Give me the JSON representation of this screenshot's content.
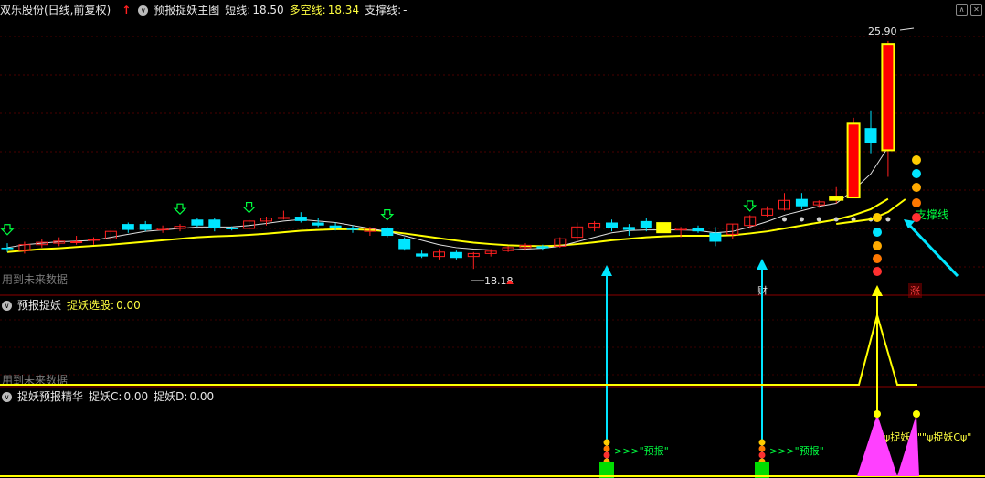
{
  "main_panel": {
    "title": "双乐股份(日线,前复权)",
    "indicator_name": "预报捉妖主图",
    "short_label": "短线:",
    "short_value": "18.50",
    "multi_label": "多空线:",
    "multi_value": "18.34",
    "support_label": "支撑线:",
    "support_value": "-",
    "future_note": "用到未来数据",
    "high_label": "25.90",
    "low_label": "18.18",
    "support_line_label": "支撑线",
    "cai_label": "财",
    "zhang_label": "涨"
  },
  "panel2": {
    "title": "预报捉妖",
    "field_label": "捉妖选股:",
    "field_value": "0.00",
    "future_note": "用到未来数据"
  },
  "panel3": {
    "title": "捉妖预报精华",
    "c_label": "捉妖C:",
    "c_value": "0.00",
    "d_label": "捉妖D:",
    "d_value": "0.00",
    "signal_text_1": ">>>\"预报\"",
    "signal_text_2": ">>>\"预报\"",
    "signal_text_3": "\"ψ捉妖C\"\"ψ捉妖Cψ\""
  },
  "colors": {
    "up": "#ff2020",
    "down": "#00e5ff",
    "ma": "#ffff00",
    "magenta": "#ff40ff",
    "green": "#00dd00"
  },
  "chart_data": {
    "type": "candlestick",
    "ohlc": [
      [
        18.9,
        19.05,
        18.75,
        18.85
      ],
      [
        18.8,
        19.1,
        18.7,
        19.0
      ],
      [
        19.0,
        19.2,
        18.9,
        19.08
      ],
      [
        19.05,
        19.25,
        18.95,
        19.12
      ],
      [
        19.1,
        19.3,
        19.0,
        19.1
      ],
      [
        19.15,
        19.25,
        19.0,
        19.18
      ],
      [
        19.2,
        19.5,
        19.1,
        19.45
      ],
      [
        19.7,
        19.75,
        19.4,
        19.5
      ],
      [
        19.7,
        19.8,
        19.45,
        19.5
      ],
      [
        19.5,
        19.65,
        19.4,
        19.55
      ],
      [
        19.55,
        19.7,
        19.45,
        19.62
      ],
      [
        19.85,
        19.9,
        19.6,
        19.65
      ],
      [
        19.85,
        19.9,
        19.45,
        19.55
      ],
      [
        19.55,
        19.62,
        19.48,
        19.52
      ],
      [
        19.55,
        19.85,
        19.5,
        19.8
      ],
      [
        19.8,
        19.95,
        19.65,
        19.9
      ],
      [
        19.9,
        20.15,
        19.85,
        19.92
      ],
      [
        19.95,
        20.1,
        19.75,
        19.8
      ],
      [
        19.75,
        19.9,
        19.6,
        19.65
      ],
      [
        19.65,
        19.75,
        19.48,
        19.55
      ],
      [
        19.55,
        19.65,
        19.4,
        19.5
      ],
      [
        19.45,
        19.6,
        19.3,
        19.55
      ],
      [
        19.55,
        19.6,
        19.25,
        19.3
      ],
      [
        19.2,
        19.25,
        18.8,
        18.85
      ],
      [
        18.7,
        18.8,
        18.55,
        18.6
      ],
      [
        18.6,
        18.85,
        18.5,
        18.75
      ],
      [
        18.75,
        18.8,
        18.5,
        18.55
      ],
      [
        18.6,
        18.75,
        18.18,
        18.7
      ],
      [
        18.7,
        18.85,
        18.6,
        18.78
      ],
      [
        18.8,
        18.95,
        18.75,
        18.9
      ],
      [
        18.9,
        19.05,
        18.8,
        18.98
      ],
      [
        18.95,
        19.0,
        18.8,
        18.88
      ],
      [
        18.95,
        19.25,
        18.9,
        19.2
      ],
      [
        19.25,
        19.75,
        19.1,
        19.6
      ],
      [
        19.6,
        19.8,
        19.45,
        19.72
      ],
      [
        19.75,
        19.85,
        19.45,
        19.55
      ],
      [
        19.6,
        19.7,
        19.3,
        19.5
      ],
      [
        19.8,
        19.9,
        19.45,
        19.55
      ],
      [
        19.7,
        19.75,
        19.4,
        19.45
      ],
      [
        19.5,
        19.6,
        19.25,
        19.55
      ],
      [
        19.55,
        19.65,
        19.4,
        19.45
      ],
      [
        19.4,
        19.6,
        18.95,
        19.1
      ],
      [
        19.35,
        19.7,
        19.2,
        19.7
      ],
      [
        19.65,
        20.0,
        19.55,
        19.95
      ],
      [
        20.0,
        20.3,
        19.95,
        20.2
      ],
      [
        20.2,
        20.75,
        20.15,
        20.5
      ],
      [
        20.55,
        20.75,
        20.2,
        20.3
      ],
      [
        20.35,
        20.5,
        20.25,
        20.45
      ],
      [
        20.55,
        20.95,
        20.4,
        20.6
      ],
      [
        20.6,
        23.3,
        20.6,
        23.1
      ],
      [
        22.95,
        23.55,
        22.1,
        22.45
      ],
      [
        22.2,
        25.9,
        21.3,
        25.8
      ]
    ],
    "ma_short": [
      18.9,
      19.0,
      19.05,
      19.1,
      19.12,
      19.15,
      19.25,
      19.35,
      19.45,
      19.5,
      19.55,
      19.6,
      19.6,
      19.6,
      19.65,
      19.72,
      19.8,
      19.85,
      19.8,
      19.75,
      19.65,
      19.55,
      19.45,
      19.3,
      19.15,
      19.0,
      18.9,
      18.85,
      18.82,
      18.82,
      18.85,
      18.88,
      18.95,
      19.1,
      19.25,
      19.4,
      19.48,
      19.5,
      19.5,
      19.5,
      19.48,
      19.4,
      19.45,
      19.6,
      19.78,
      20.0,
      20.15,
      20.3,
      20.4,
      20.85,
      21.4,
      22.3
    ],
    "ma_long": [
      18.75,
      18.8,
      18.85,
      18.88,
      18.92,
      18.96,
      19.0,
      19.05,
      19.1,
      19.15,
      19.2,
      19.25,
      19.28,
      19.3,
      19.33,
      19.37,
      19.42,
      19.47,
      19.5,
      19.52,
      19.52,
      19.5,
      19.45,
      19.38,
      19.3,
      19.22,
      19.14,
      19.07,
      19.02,
      18.98,
      18.96,
      18.95,
      18.97,
      19.02,
      19.08,
      19.15,
      19.2,
      19.25,
      19.28,
      19.3,
      19.3,
      19.3,
      19.32,
      19.38,
      19.45,
      19.55,
      19.65,
      19.75,
      19.85,
      20.0,
      20.2,
      20.55
    ],
    "ylim": [
      18.0,
      26.3
    ],
    "signals_down_arrow": [
      0,
      10,
      14,
      22,
      43
    ],
    "yellow_blocks": [
      38,
      48
    ],
    "zhuoyao_select": {
      "spike_index": 55,
      "peak": 1.0
    },
    "zhuoyao_c": {
      "peaks": [
        55,
        57
      ],
      "values": [
        1.0,
        1.0
      ]
    }
  }
}
